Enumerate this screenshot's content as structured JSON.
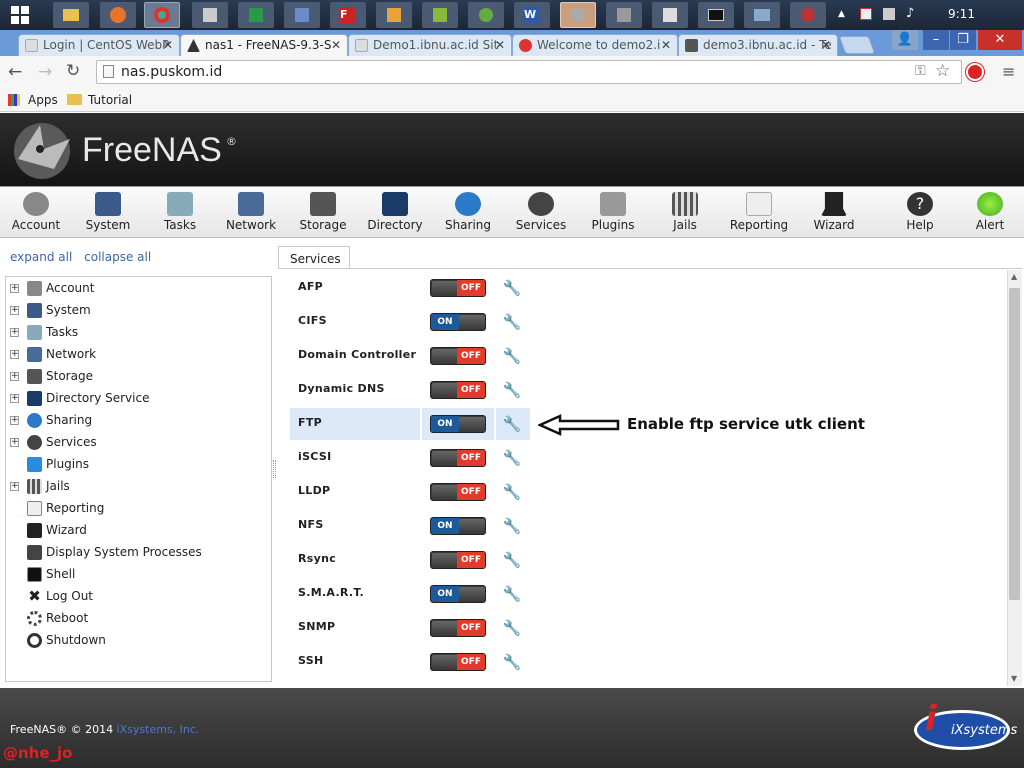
{
  "taskbar": {
    "time": "9:11"
  },
  "browser": {
    "tabs": [
      {
        "label": "Login | CentOS WebP"
      },
      {
        "label": "nas1 - FreeNAS-9.3-S"
      },
      {
        "label": "Demo1.ibnu.ac.id Sit"
      },
      {
        "label": "Welcome to demo2.i"
      },
      {
        "label": "demo3.ibnu.ac.id - Te"
      }
    ],
    "url": "nas.puskom.id",
    "bookmarks": {
      "apps": "Apps",
      "tutorial": "Tutorial"
    }
  },
  "app": {
    "logo": "FreeNAS",
    "toolbar": [
      "Account",
      "System",
      "Tasks",
      "Network",
      "Storage",
      "Directory",
      "Sharing",
      "Services",
      "Plugins",
      "Jails",
      "Reporting",
      "Wizard",
      "Help",
      "Alert"
    ]
  },
  "sidebar": {
    "expand_all": "expand all",
    "collapse_all": "collapse all",
    "items": [
      {
        "label": "Account",
        "expandable": true
      },
      {
        "label": "System",
        "expandable": true
      },
      {
        "label": "Tasks",
        "expandable": true
      },
      {
        "label": "Network",
        "expandable": true
      },
      {
        "label": "Storage",
        "expandable": true
      },
      {
        "label": "Directory Service",
        "expandable": true
      },
      {
        "label": "Sharing",
        "expandable": true
      },
      {
        "label": "Services",
        "expandable": true
      },
      {
        "label": "Plugins",
        "expandable": false
      },
      {
        "label": "Jails",
        "expandable": true
      },
      {
        "label": "Reporting",
        "expandable": false
      },
      {
        "label": "Wizard",
        "expandable": false
      },
      {
        "label": "Display System Processes",
        "expandable": false
      },
      {
        "label": "Shell",
        "expandable": false
      },
      {
        "label": "Log Out",
        "expandable": false
      },
      {
        "label": "Reboot",
        "expandable": false
      },
      {
        "label": "Shutdown",
        "expandable": false
      }
    ]
  },
  "main": {
    "tab": "Services",
    "services": [
      {
        "name": "AFP",
        "state": "OFF"
      },
      {
        "name": "CIFS",
        "state": "ON"
      },
      {
        "name": "Domain Controller",
        "state": "OFF"
      },
      {
        "name": "Dynamic DNS",
        "state": "OFF"
      },
      {
        "name": "FTP",
        "state": "ON",
        "highlight": true
      },
      {
        "name": "iSCSI",
        "state": "OFF"
      },
      {
        "name": "LLDP",
        "state": "OFF"
      },
      {
        "name": "NFS",
        "state": "ON"
      },
      {
        "name": "Rsync",
        "state": "OFF"
      },
      {
        "name": "S.M.A.R.T.",
        "state": "ON"
      },
      {
        "name": "SNMP",
        "state": "OFF"
      },
      {
        "name": "SSH",
        "state": "OFF"
      }
    ],
    "annotation": "Enable ftp service utk client"
  },
  "footer": {
    "copyright": "FreeNAS® © 2014",
    "company_link": "iXsystems, Inc.",
    "ix_logo": "iXsystems",
    "watermark": "@nhe_jo"
  },
  "colors": {
    "on": "#1d5a9a",
    "off": "#e23b2a",
    "highlight": "#dbe9f9",
    "link": "#3a66a8"
  }
}
